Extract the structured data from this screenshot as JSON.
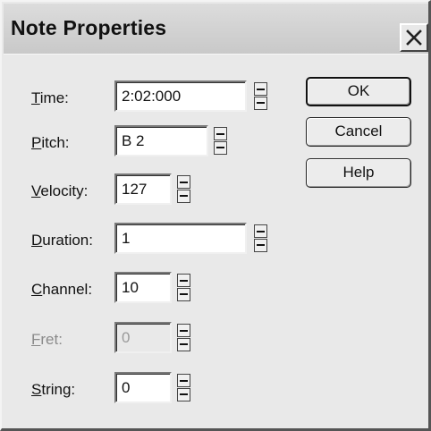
{
  "window": {
    "title": "Note Properties",
    "close_icon": "close-icon"
  },
  "fields": [
    {
      "key": "time",
      "label_mnemonic": "T",
      "label_rest": "ime:",
      "value": "2:02:000",
      "enabled": true
    },
    {
      "key": "pitch",
      "label_mnemonic": "P",
      "label_rest": "itch:",
      "value": "B 2",
      "enabled": true
    },
    {
      "key": "velocity",
      "label_mnemonic": "V",
      "label_rest": "elocity:",
      "value": "127",
      "enabled": true
    },
    {
      "key": "duration",
      "label_mnemonic": "D",
      "label_rest": "uration:",
      "value": "1",
      "enabled": true
    },
    {
      "key": "channel",
      "label_mnemonic": "C",
      "label_rest": "hannel:",
      "value": "10",
      "enabled": true
    },
    {
      "key": "fret",
      "label_mnemonic": "F",
      "label_rest": "ret:",
      "value": "0",
      "enabled": false
    },
    {
      "key": "string",
      "label_mnemonic": "S",
      "label_rest": "tring:",
      "value": "0",
      "enabled": true
    }
  ],
  "buttons": {
    "ok": "OK",
    "cancel": "Cancel",
    "help": "Help"
  },
  "icons": {
    "spin_up": "spin-up-icon",
    "spin_down": "spin-down-icon"
  }
}
